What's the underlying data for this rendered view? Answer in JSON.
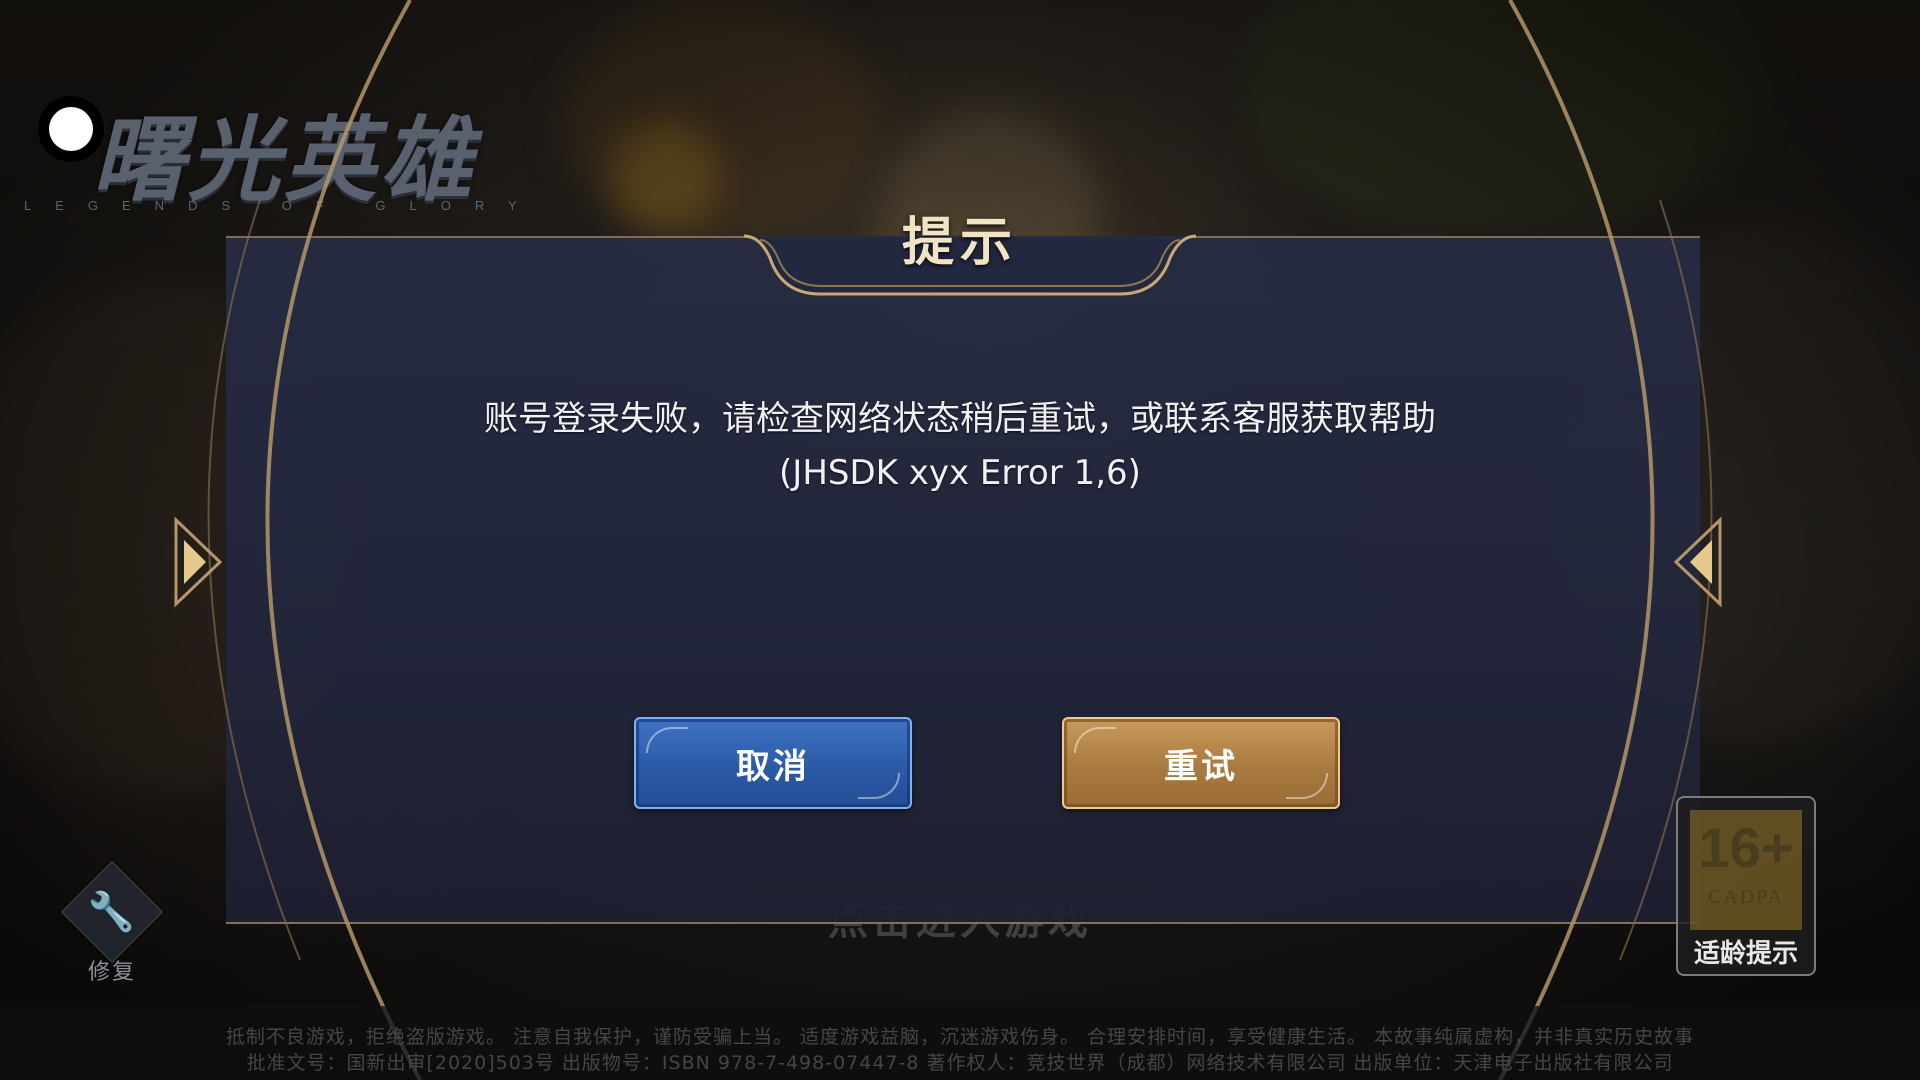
{
  "logo": {
    "title": "曙光英雄",
    "subtitle": "LEGENDS OF GLORY"
  },
  "dialog": {
    "title": "提示",
    "message": "账号登录失败，请检查网络状态稍后重试，或联系客服获取帮助(JHSDK xyx Error 1,6)",
    "cancel_label": "取消",
    "retry_label": "重试"
  },
  "background": {
    "enter_game": "点击进入游戏"
  },
  "repair": {
    "label": "修复",
    "icon": "wrench-icon"
  },
  "age_rating": {
    "age": "16+",
    "org": "CADPA",
    "label": "适龄提示"
  },
  "footer": {
    "line1": "抵制不良游戏，拒绝盗版游戏。 注意自我保护，谨防受骗上当。 适度游戏益脑，沉迷游戏伤身。 合理安排时间，享受健康生活。 本故事纯属虚构，并非真实历史故事",
    "line2": "批准文号：国新出审[2020]503号  出版物号：ISBN 978-7-498-07447-8  著作权人：竞技世界（成都）网络技术有限公司  出版单位：天津电子出版社有限公司"
  },
  "colors": {
    "dialog_bg": "#262c44",
    "frame_gold": "#b4966a",
    "cancel_blue": "#2b5aa7",
    "retry_gold": "#a97a40",
    "title_text": "#f2e3c4"
  }
}
